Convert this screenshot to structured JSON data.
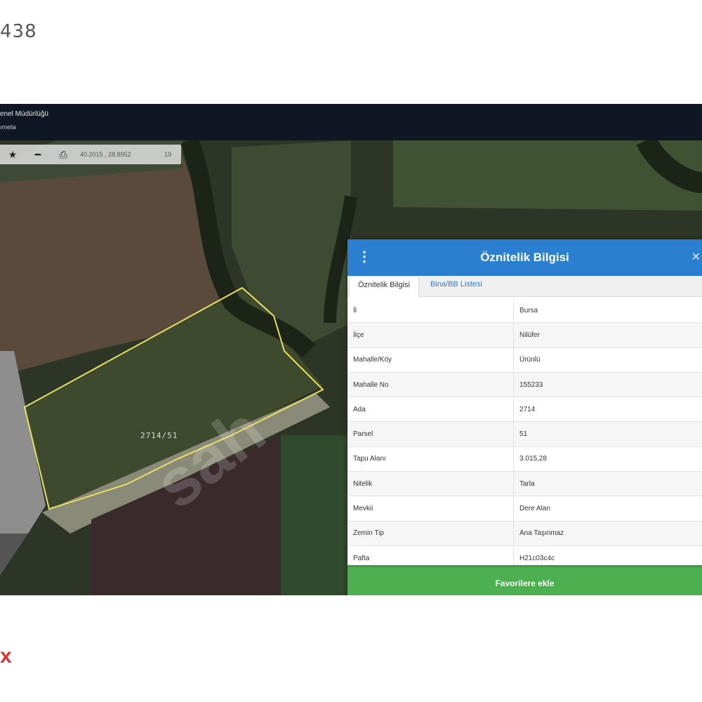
{
  "listing": {
    "id_fragment": "438",
    "bottom_mark": "x"
  },
  "header": {
    "line1": "enel Müdürlüğü",
    "line2": "ımeta"
  },
  "toolbar": {
    "star_icon": "star-icon",
    "minus_icon": "minus-icon",
    "print_icon": "print-icon",
    "coords": "40.2015 , 28.8952",
    "zoom": "19"
  },
  "map": {
    "parcel_label": "2714/51",
    "watermark": "sah",
    "parcel_outline_color": "#e8e060"
  },
  "panel": {
    "title": "Öznitelik Bilgisi",
    "menu_icon": "vertical-dots-icon",
    "close_icon": "close-icon",
    "header_color": "#2a7fd0",
    "tabs": [
      {
        "label": "Öznitelik Bilgisi",
        "active": true
      },
      {
        "label": "Bina/BB Listesi",
        "active": false
      }
    ],
    "rows": [
      {
        "key": "İl",
        "value": "Bursa"
      },
      {
        "key": "İlçe",
        "value": "Nilüfer"
      },
      {
        "key": "Mahalle/Köy",
        "value": "Ürünlü"
      },
      {
        "key": "Mahalle No",
        "value": "155233"
      },
      {
        "key": "Ada",
        "value": "2714"
      },
      {
        "key": "Parsel",
        "value": "51"
      },
      {
        "key": "Tapu Alanı",
        "value": "3.015,28"
      },
      {
        "key": "Nitelik",
        "value": "Tarla"
      },
      {
        "key": "Mevkii",
        "value": "Dere Alan"
      },
      {
        "key": "Zemin Tip",
        "value": "Ana Taşınmaz"
      },
      {
        "key": "Pafta",
        "value": "H21c03c4c"
      }
    ],
    "favorite_button": "Favorilere ekle",
    "favorite_color": "#4caf50"
  }
}
